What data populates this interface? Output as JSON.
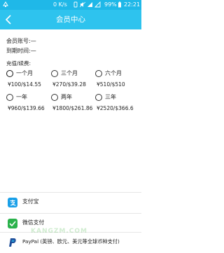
{
  "status_bar": {
    "net_speed": "0 K/s",
    "battery": "99%",
    "time": "22:21"
  },
  "header": {
    "title": "会员中心"
  },
  "account": {
    "account_label": "会员账号:—",
    "expiry_label": "到期时间:—"
  },
  "plans": {
    "section_label": "充值/续费:",
    "options": [
      {
        "label": "一个月",
        "price": "¥100/$14.55",
        "selected": true
      },
      {
        "label": "三个月",
        "price": "¥270/$39.28",
        "selected": false
      },
      {
        "label": "六个月",
        "price": "¥510/$510",
        "selected": false
      },
      {
        "label": "一年",
        "price": "¥960/$139.66",
        "selected": false
      },
      {
        "label": "两年",
        "price": "¥1800/$261.86",
        "selected": false
      },
      {
        "label": "三年",
        "price": "¥2520/$366.6",
        "selected": false
      }
    ]
  },
  "payment": {
    "methods": [
      {
        "label": "支付宝",
        "icon": "alipay-icon"
      },
      {
        "label": "微信支付",
        "icon": "wechat-pay-icon"
      },
      {
        "label": "PayPal (英镑、欧元、美元等全球币种支付)",
        "icon": "paypal-icon"
      }
    ]
  },
  "watermark": "KANGZM.COM",
  "colors": {
    "status_bar": "#1fb8e8",
    "header": "#2ec3ee",
    "alipay": "#1aa0e8",
    "wechat": "#2bb24c",
    "paypal": "#1e4e9a"
  }
}
